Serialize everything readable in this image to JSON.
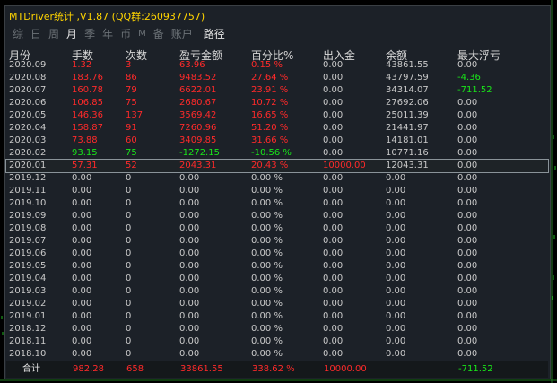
{
  "window": {
    "title": "MTDriver统计 ,V1.87 (QQ群:260937757)"
  },
  "tabs": [
    {
      "label": "综",
      "active": false
    },
    {
      "label": "日",
      "active": false
    },
    {
      "label": "周",
      "active": false
    },
    {
      "label": "月",
      "active": true
    },
    {
      "label": "季",
      "active": false
    },
    {
      "label": "年",
      "active": false
    },
    {
      "label": "币",
      "active": false
    },
    {
      "label": "M",
      "active": false
    },
    {
      "label": "备",
      "active": false
    },
    {
      "label": "账户",
      "active": false
    },
    {
      "label": "路径",
      "active": false
    }
  ],
  "columns": [
    "月份",
    "手数",
    "次数",
    "盈亏金额",
    "百分比%",
    "出入金",
    "余额",
    "最大浮亏"
  ],
  "rows": [
    [
      "2020.09",
      "1.32",
      "3",
      "63.96",
      "0.15 %",
      "0.00",
      "43861.55",
      "0.00"
    ],
    [
      "2020.08",
      "183.76",
      "86",
      "9483.52",
      "27.64 %",
      "0.00",
      "43797.59",
      "-4.36"
    ],
    [
      "2020.07",
      "160.78",
      "79",
      "6622.01",
      "23.91 %",
      "0.00",
      "34314.07",
      "-711.52"
    ],
    [
      "2020.06",
      "106.85",
      "75",
      "2680.67",
      "10.72 %",
      "0.00",
      "27692.06",
      "0.00"
    ],
    [
      "2020.05",
      "146.36",
      "137",
      "3569.42",
      "16.65 %",
      "0.00",
      "25011.39",
      "0.00"
    ],
    [
      "2020.04",
      "158.87",
      "91",
      "7260.96",
      "51.20 %",
      "0.00",
      "21441.97",
      "0.00"
    ],
    [
      "2020.03",
      "73.88",
      "60",
      "3409.85",
      "31.66 %",
      "0.00",
      "14181.01",
      "0.00"
    ],
    [
      "2020.02",
      "93.15",
      "75",
      "-1272.15",
      "-10.56 %",
      "0.00",
      "10771.16",
      "0.00"
    ],
    [
      "2020.01",
      "57.31",
      "52",
      "2043.31",
      "20.43 %",
      "10000.00",
      "12043.31",
      "0.00"
    ],
    [
      "2019.12",
      "0.00",
      "0",
      "0.00",
      "0.00 %",
      "0.00",
      "0.00",
      "0.00"
    ],
    [
      "2019.11",
      "0.00",
      "0",
      "0.00",
      "0.00 %",
      "0.00",
      "0.00",
      "0.00"
    ],
    [
      "2019.10",
      "0.00",
      "0",
      "0.00",
      "0.00 %",
      "0.00",
      "0.00",
      "0.00"
    ],
    [
      "2019.09",
      "0.00",
      "0",
      "0.00",
      "0.00 %",
      "0.00",
      "0.00",
      "0.00"
    ],
    [
      "2019.08",
      "0.00",
      "0",
      "0.00",
      "0.00 %",
      "0.00",
      "0.00",
      "0.00"
    ],
    [
      "2019.07",
      "0.00",
      "0",
      "0.00",
      "0.00 %",
      "0.00",
      "0.00",
      "0.00"
    ],
    [
      "2019.06",
      "0.00",
      "0",
      "0.00",
      "0.00 %",
      "0.00",
      "0.00",
      "0.00"
    ],
    [
      "2019.05",
      "0.00",
      "0",
      "0.00",
      "0.00 %",
      "0.00",
      "0.00",
      "0.00"
    ],
    [
      "2019.04",
      "0.00",
      "0",
      "0.00",
      "0.00 %",
      "0.00",
      "0.00",
      "0.00"
    ],
    [
      "2019.03",
      "0.00",
      "0",
      "0.00",
      "0.00 %",
      "0.00",
      "0.00",
      "0.00"
    ],
    [
      "2019.02",
      "0.00",
      "0",
      "0.00",
      "0.00 %",
      "0.00",
      "0.00",
      "0.00"
    ],
    [
      "2019.01",
      "0.00",
      "0",
      "0.00",
      "0.00 %",
      "0.00",
      "0.00",
      "0.00"
    ],
    [
      "2018.12",
      "0.00",
      "0",
      "0.00",
      "0.00 %",
      "0.00",
      "0.00",
      "0.00"
    ],
    [
      "2018.11",
      "0.00",
      "0",
      "0.00",
      "0.00 %",
      "0.00",
      "0.00",
      "0.00"
    ],
    [
      "2018.10",
      "0.00",
      "0",
      "0.00",
      "0.00 %",
      "0.00",
      "0.00",
      "0.00"
    ]
  ],
  "row_colors": [
    "red",
    "red",
    "red",
    "red",
    "red",
    "red",
    "red",
    "green",
    "red",
    "gray",
    "gray",
    "gray",
    "gray",
    "gray",
    "gray",
    "gray",
    "gray",
    "gray",
    "gray",
    "gray",
    "gray",
    "gray",
    "gray",
    "gray"
  ],
  "selected_row": "2020.01",
  "footer": {
    "label": "合计",
    "lots": "982.28",
    "count": "658",
    "profit": "33861.55",
    "percent": "338.62 %",
    "deposit": "10000.00",
    "balance": "",
    "max_drawdown": "-711.52"
  },
  "colors": {
    "title": "#ffd400",
    "red": "#ff2a2a",
    "green": "#19e619",
    "gray": "#c9c9c9",
    "white": "#e6e6e6"
  }
}
